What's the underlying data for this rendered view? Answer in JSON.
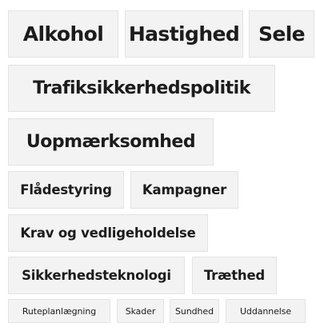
{
  "tag_cloud": {
    "tags": [
      {
        "label": "Alkohol",
        "size": "xl"
      },
      {
        "label": "Hastighed",
        "size": "xl"
      },
      {
        "label": "Sele",
        "size": "xl"
      },
      {
        "label": "Trafiksikkerhedspolitik",
        "size": "lg"
      },
      {
        "label": "Uopmærksomhed",
        "size": "lg"
      },
      {
        "label": "Flådestyring",
        "size": "md"
      },
      {
        "label": "Kampagner",
        "size": "md"
      },
      {
        "label": "Krav og vedligeholdelse",
        "size": "md"
      },
      {
        "label": "Sikkerhedsteknologi",
        "size": "md"
      },
      {
        "label": "Træthed",
        "size": "md"
      },
      {
        "label": "Ruteplanlægning",
        "size": "sm"
      },
      {
        "label": "Skader",
        "size": "sm"
      },
      {
        "label": "Sundhed",
        "size": "sm"
      },
      {
        "label": "Uddannelse",
        "size": "sm"
      }
    ]
  },
  "colors": {
    "tag_background": "#f3f3f3",
    "tag_border": "#e3e3e3",
    "tag_text": "#1c1c1c",
    "page_background": "#ffffff"
  }
}
